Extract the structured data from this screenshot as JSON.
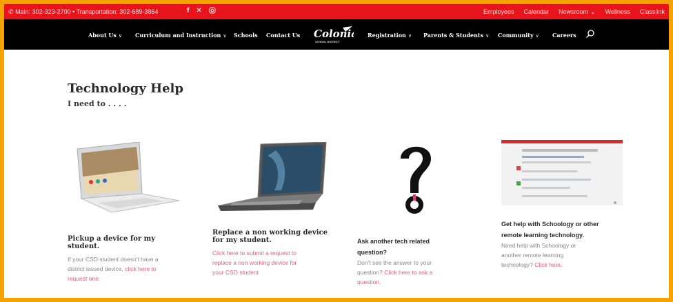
{
  "topbar": {
    "contact": "Main: 302-323-2700 • Transportation: 302-689-3864",
    "links": [
      "Employees",
      "Calendar",
      "Newsroom",
      "Wellness",
      "Classlink"
    ]
  },
  "nav": {
    "left": [
      "About Us",
      "Curriculum and Instruction",
      "Schools",
      "Contact Us"
    ],
    "right": [
      "Registration",
      "Parents & Students",
      "Community",
      "Careers"
    ],
    "logo_text": "Colonial",
    "logo_sub": "SCHOOL DISTRICT"
  },
  "page": {
    "title": "Technology Help",
    "subtitle": "I need to . . . ."
  },
  "cards": [
    {
      "heading_1": "Pickup a device for my",
      "heading_2": "student.",
      "text_1": "If your CSD student doesn't have a",
      "text_2": "district issued device,",
      "link_1": "click here to",
      "link_2": "request one."
    },
    {
      "heading_1": "Replace a non working device",
      "heading_2": "for my student.",
      "link_1": "Click here to submit a request to",
      "link_2": "replace a non working device for",
      "link_3": "your CSD student"
    },
    {
      "heading_1": "Ask another tech related",
      "heading_2": "question?",
      "text_1": "Don't see the answer to your",
      "text_2": "question?",
      "link_1": "Click here to ask a",
      "link_2": "question."
    },
    {
      "heading_1": "Get help with Schoology or other",
      "heading_2": "remote learning technology.",
      "text_1": "Need help with Schoology or",
      "text_2": "another remote learning",
      "text_3": "technology?",
      "link_1": "Click here."
    }
  ]
}
